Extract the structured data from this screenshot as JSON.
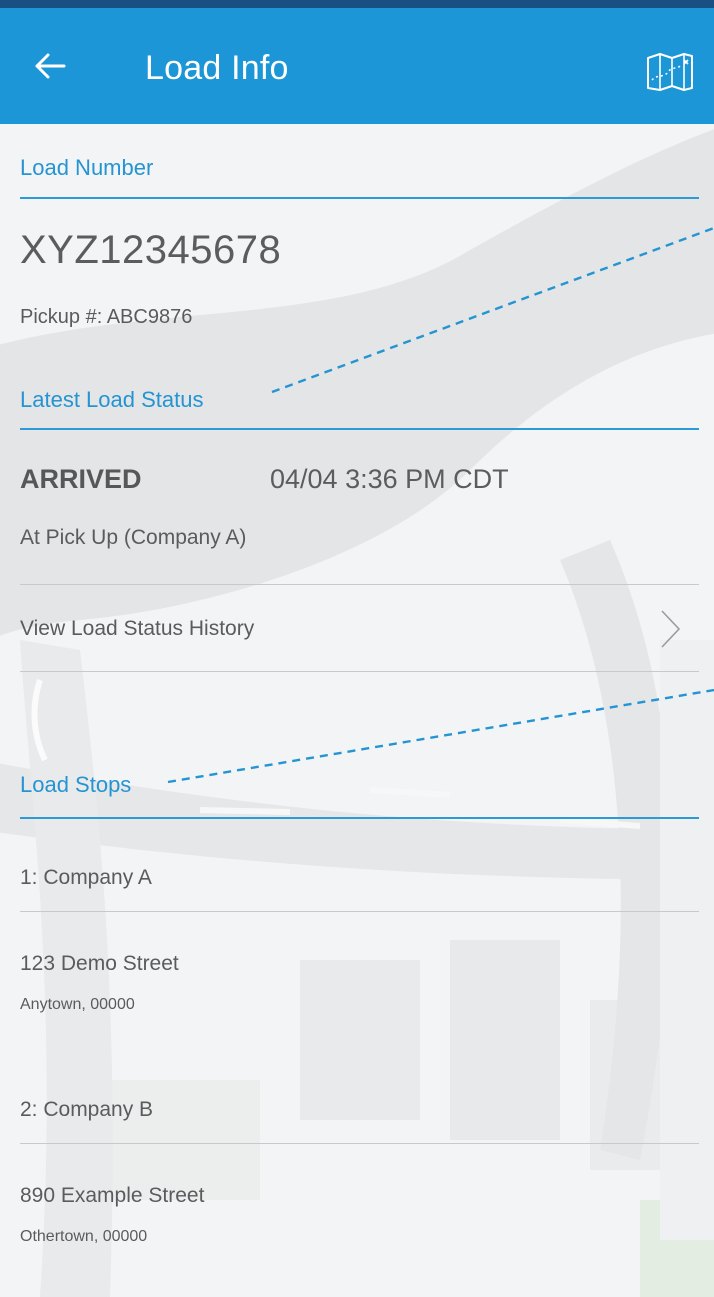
{
  "app_bar": {
    "title": "Load Info",
    "back_icon": "arrow-left-icon",
    "map_icon": "folded-map-icon",
    "color": "#1c96d7"
  },
  "load_number": {
    "heading": "Load Number",
    "value": "XYZ12345678",
    "pickup": "Pickup #: ABC9876"
  },
  "latest_status": {
    "heading": "Latest Load Status",
    "status": "ARRIVED",
    "timestamp": "04/04 3:36 PM CDT",
    "location": "At Pick Up (Company A)",
    "history_link": "View Load Status History"
  },
  "load_stops": {
    "heading": "Load Stops",
    "stops": [
      {
        "name": "1: Company A",
        "street": "123 Demo Street",
        "city": "Anytown,  00000"
      },
      {
        "name": "2: Company B",
        "street": "890 Example Street",
        "city": "Othertown,  00000"
      }
    ]
  },
  "colors": {
    "accent": "#2594d2",
    "text": "#595c5f",
    "divider": "#c7cacc"
  }
}
